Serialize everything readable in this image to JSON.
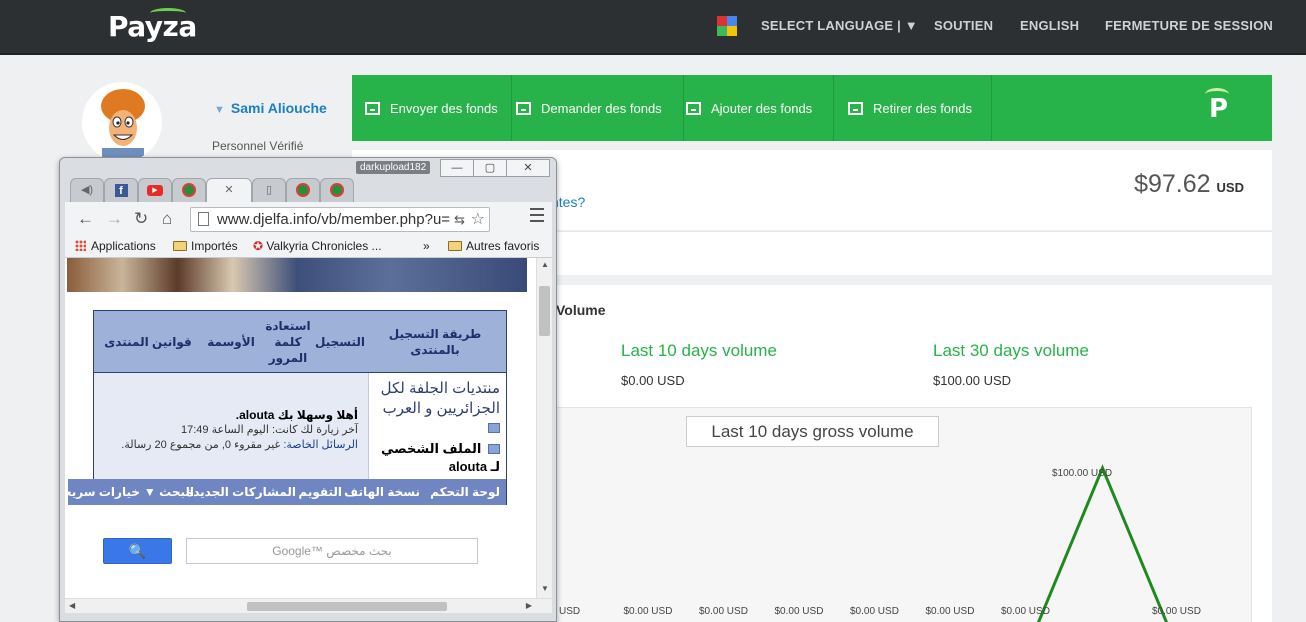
{
  "topbar": {
    "logo": "Payza",
    "nav": {
      "select_language": "SELECT LANGUAGE | ▼",
      "support": "SOUTIEN",
      "english": "ENGLISH",
      "logout": "FERMETURE DE SESSION"
    }
  },
  "profile": {
    "name": "Sami Aliouche",
    "status": "Personnel Vérifié"
  },
  "actions": {
    "send": "Envoyer des fonds",
    "request": "Demander des fonds",
    "add": "Ajouter des fonds",
    "withdraw": "Retirer des fonds",
    "badge": "P"
  },
  "balance": {
    "link": "ntes?",
    "amount": "$97.62",
    "currency": "USD"
  },
  "volume": {
    "title": "Volume",
    "last10_label": "Last 10 days volume",
    "last10_value": "$0.00 USD",
    "last30_label": "Last 30 days volume",
    "last30_value": "$100.00 USD",
    "chart_title": "Last 10 days gross volume",
    "peak_label": "$100.00 USD",
    "ticks": [
      "USD",
      "$0.00 USD",
      "$0.00 USD",
      "$0.00 USD",
      "$0.00 USD",
      "$0.00 USD",
      "$0.00 USD",
      "$0.00 USD"
    ]
  },
  "chart_data": {
    "type": "line",
    "title": "Last 10 days gross volume",
    "x": [
      "",
      "",
      "",
      "",
      "",
      "",
      "",
      "",
      ""
    ],
    "series": [
      {
        "values": [
          0,
          0,
          0,
          0,
          0,
          0,
          0,
          100,
          0
        ]
      }
    ],
    "ylim": [
      0,
      100
    ],
    "data_labels": [
      "USD",
      "$0.00 USD",
      "$0.00 USD",
      "$0.00 USD",
      "$0.00 USD",
      "$0.00 USD",
      "$0.00 USD",
      "$100.00 USD",
      "$0.00 USD"
    ],
    "line_color": "#1f8a1f"
  },
  "chrome": {
    "user_tag": "darkupload182",
    "win": {
      "min": "—",
      "max": "▢",
      "close": "✕"
    },
    "tabs": {
      "active_close": "✕"
    },
    "toolbar": {
      "back": "←",
      "forward": "→",
      "reload": "↻",
      "home": "⌂"
    },
    "url": "www.djelfa.info/vb/member.php?u=",
    "bookmarks": {
      "apps": "Applications",
      "imported": "Importés",
      "valkyria": "Valkyria Chronicles ...",
      "more": "»",
      "other": "Autres favoris"
    },
    "forum": {
      "head": {
        "registration_method": "طريقة التسجيل بالمنتدى",
        "register": "التسجيل",
        "recover_password": "استعادة كلمة المرور",
        "medals": "الأوسمة",
        "rules": "قوانين المنتدى"
      },
      "site_title": "منتديات الجلفة لكل الجزائريين و العرب",
      "profile_label": "الملف الشخصي لـ alouta",
      "hello": "أهلا وسهلا بك alouta.",
      "last_visit": "آخر زيارة لك كانت: اليوم الساعة 17:49",
      "pm_label": "الرسائل الخاصة:",
      "pm_value": "غير مقروء 0, من مجموع 20 رسالة.",
      "nav": {
        "control_panel": "لوحة التحكم",
        "mobile": "نسخة الهاتف",
        "calendar": "التقويم",
        "new_posts": "المشاركات الجديدة",
        "search": "البحث ▼",
        "quick_options": "خيارات سريعة"
      },
      "search_placeholder": "Google™ بحث مخصص",
      "search_button": "🔍"
    }
  }
}
